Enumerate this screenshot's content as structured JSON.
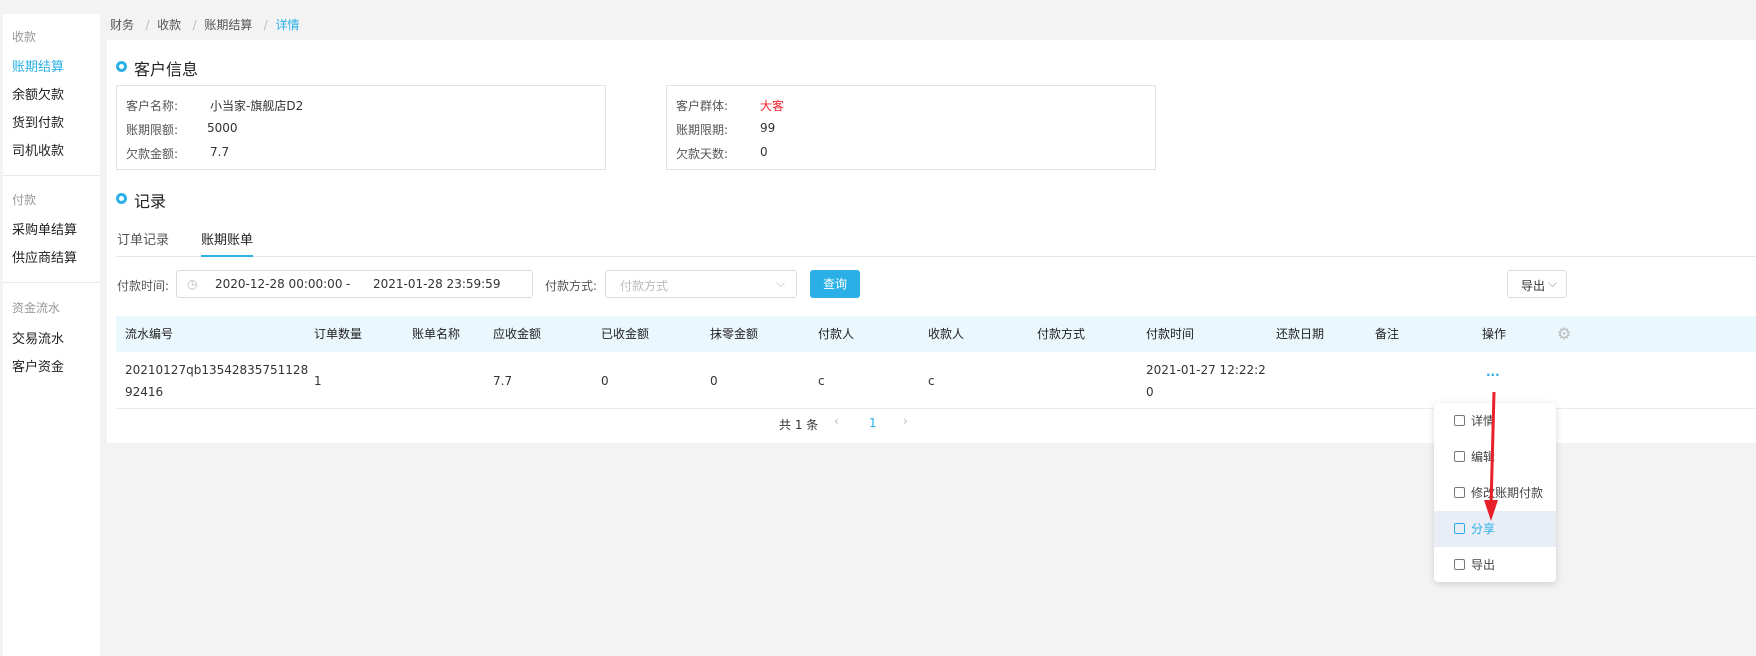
{
  "breadcrumb": [
    "财务",
    "收款",
    "账期结算",
    "详情"
  ],
  "sidebar": {
    "groups": [
      {
        "title": "收款",
        "items": [
          "账期结算",
          "余额欠款",
          "货到付款",
          "司机收款"
        ]
      },
      {
        "title": "付款",
        "items": [
          "采购单结算",
          "供应商结算"
        ]
      },
      {
        "title": "资金流水",
        "items": [
          "交易流水",
          "客户资金"
        ]
      }
    ]
  },
  "customer": {
    "title": "客户信息",
    "left": [
      {
        "label": "客户名称:",
        "value": "小当家-旗舰店D2"
      },
      {
        "label": "账期限额:",
        "value": "5000"
      },
      {
        "label": "欠款金额:",
        "value": "7.7"
      }
    ],
    "right": [
      {
        "label": "客户群体:",
        "value": "大客"
      },
      {
        "label": "账期限期:",
        "value": "99"
      },
      {
        "label": "欠款天数:",
        "value": "0"
      }
    ],
    "group_color": "#f5222d"
  },
  "records": {
    "title": "记录",
    "tabs": [
      "订单记录",
      "账期账单"
    ],
    "filter": {
      "time_label": "付款时间:",
      "start": "2020-12-28 00:00:00",
      "dash": "-",
      "end": "2021-01-28 23:59:59",
      "method_label": "付款方式:",
      "method_placeholder": "付款方式",
      "query": "查询",
      "export": "导出"
    },
    "columns": [
      "流水编号",
      "订单数量",
      "账单名称",
      "应收金额",
      "已收金额",
      "抹零金额",
      "付款人",
      "收款人",
      "付款方式",
      "付款时间",
      "还款日期",
      "备注",
      "操作"
    ],
    "rows": [
      {
        "id_line1": "20210127qb13542835751128",
        "id_line2": "92416",
        "count": "1",
        "name": "",
        "receivable": "7.7",
        "received": "0",
        "rounding": "0",
        "payer": "c",
        "payee": "c",
        "method": "",
        "time_line1": "2021-01-27 12:22:2",
        "time_line2": "0",
        "due": "",
        "note": "",
        "ops": "···"
      }
    ],
    "pagination": {
      "total": "共 1 条",
      "page": "1"
    }
  },
  "menu": [
    "详情",
    "编辑",
    "修改账期付款",
    "分享",
    "导出"
  ],
  "accent": "#2ab0e6"
}
